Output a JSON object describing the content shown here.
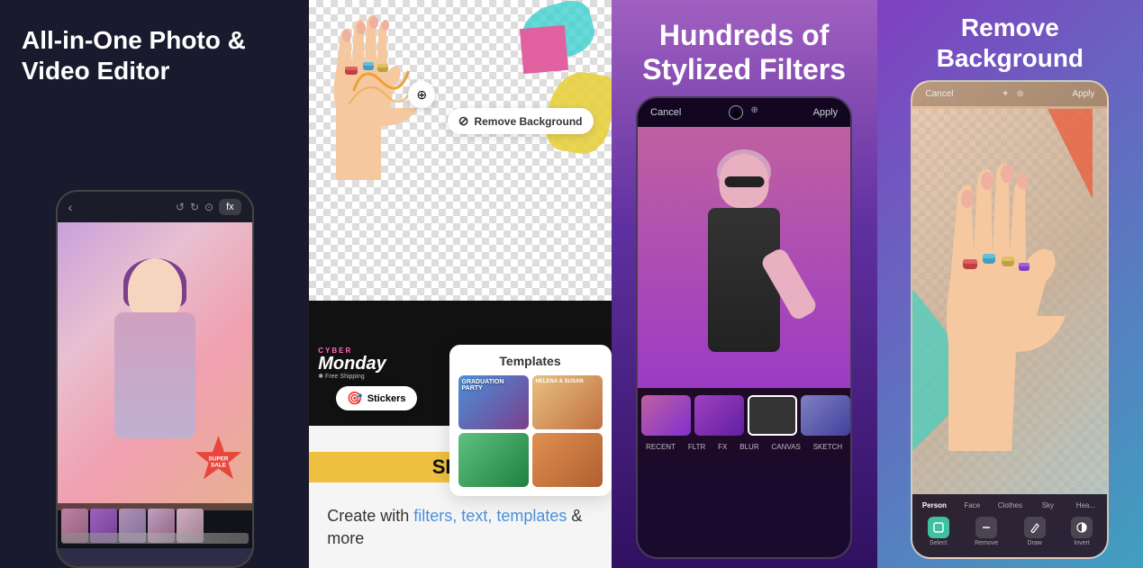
{
  "panels": [
    {
      "id": "panel-1",
      "headline": "All-in-One Photo & Video Editor",
      "theme": "dark",
      "badge": "fx",
      "label": "Effects",
      "colors": {
        "bg": "#1a1a2e",
        "accent": "#7b3f8c"
      }
    },
    {
      "id": "panel-2",
      "bottom_text_prefix": "Create with ",
      "bottom_highlights": "filters, text, templates",
      "bottom_text_suffix": " & more",
      "remove_bg_badge": "Remove Background",
      "templates_title": "Templates",
      "stickers_label": "Stickers",
      "colors": {
        "bg": "#f5f5f5",
        "highlight": "#4a90d9"
      }
    },
    {
      "id": "panel-3",
      "headline": "Hundreds of\nStylized Filters",
      "header": {
        "cancel": "Cancel",
        "apply": "Apply"
      },
      "filters": [
        "RECENT",
        "FLTR",
        "FX",
        "BLUR",
        "CANVAS",
        "SKETCH"
      ],
      "colors": {
        "bg_top": "#a060c0",
        "bg_bottom": "#301060"
      }
    },
    {
      "id": "panel-4",
      "headline": "Remove Background",
      "header": {
        "cancel": "Cancel",
        "apply": "Apply"
      },
      "categories": [
        "Person",
        "Face",
        "Clothes",
        "Sky",
        "Hea..."
      ],
      "actions": [
        "Select",
        "Remove",
        "Draw",
        "Invert"
      ],
      "colors": {
        "bg_left": "#8040c0",
        "bg_right": "#40a0c0",
        "accent": "#40c0a0"
      }
    }
  ]
}
